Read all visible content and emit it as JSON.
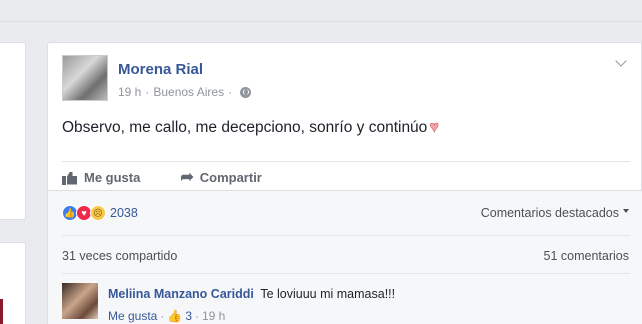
{
  "post": {
    "author": "Morena Rial",
    "time": "19 h",
    "location": "Buenos Aires",
    "text": "Observo, me callo, me decepciono, sonrío y continúo",
    "like_label": "Me gusta",
    "share_label": "Compartir",
    "reaction_count": "2038",
    "featured_comments_label": "Comentarios destacados",
    "shares_text": "31 veces compartido",
    "comments_text": "51 comentarios"
  },
  "comment": {
    "author": "Meliina Manzano Cariddi",
    "text": "Te loviuuu mi mamasa!!!",
    "like_label": "Me gusta",
    "likes": "3",
    "time": "19 h"
  },
  "colors": {
    "link_blue": "#365899",
    "card_bg": "#ffffff",
    "page_bg": "#e9ebee"
  }
}
